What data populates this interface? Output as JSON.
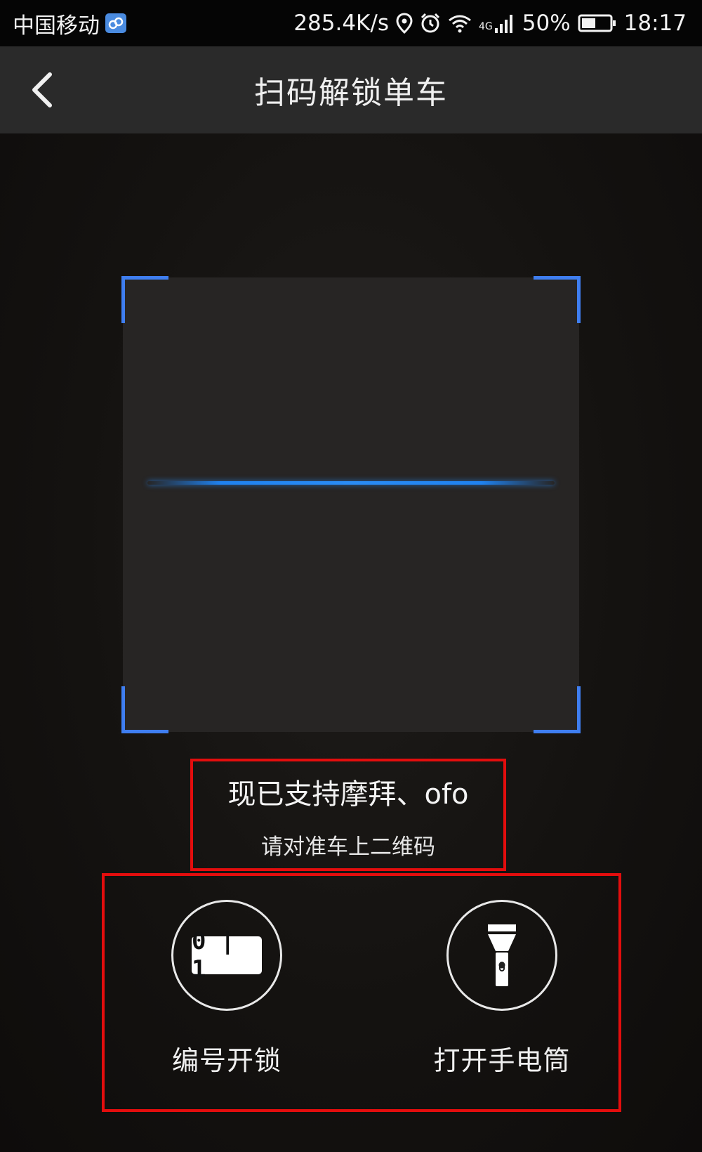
{
  "status_bar": {
    "carrier": "中国移动",
    "net_speed": "285.4K/s",
    "network_type": "4G",
    "battery": "50%",
    "time": "18:17",
    "icons": [
      "hd-badge-icon",
      "location-icon",
      "alarm-icon",
      "wifi-icon",
      "signal-icon",
      "battery-icon"
    ]
  },
  "header": {
    "title": "扫码解锁单车",
    "back_icon": "chevron-left-icon"
  },
  "scanner": {
    "accent_color": "#3f7ef0",
    "line_color": "#1f82f0"
  },
  "tip": {
    "main": "现已支持摩拜、ofo",
    "sub": "请对准车上二维码"
  },
  "actions": [
    {
      "label": "编号开锁",
      "icon": "number-code-icon",
      "code_text": "0 | 1"
    },
    {
      "label": "打开手电筒",
      "icon": "flashlight-icon"
    }
  ]
}
